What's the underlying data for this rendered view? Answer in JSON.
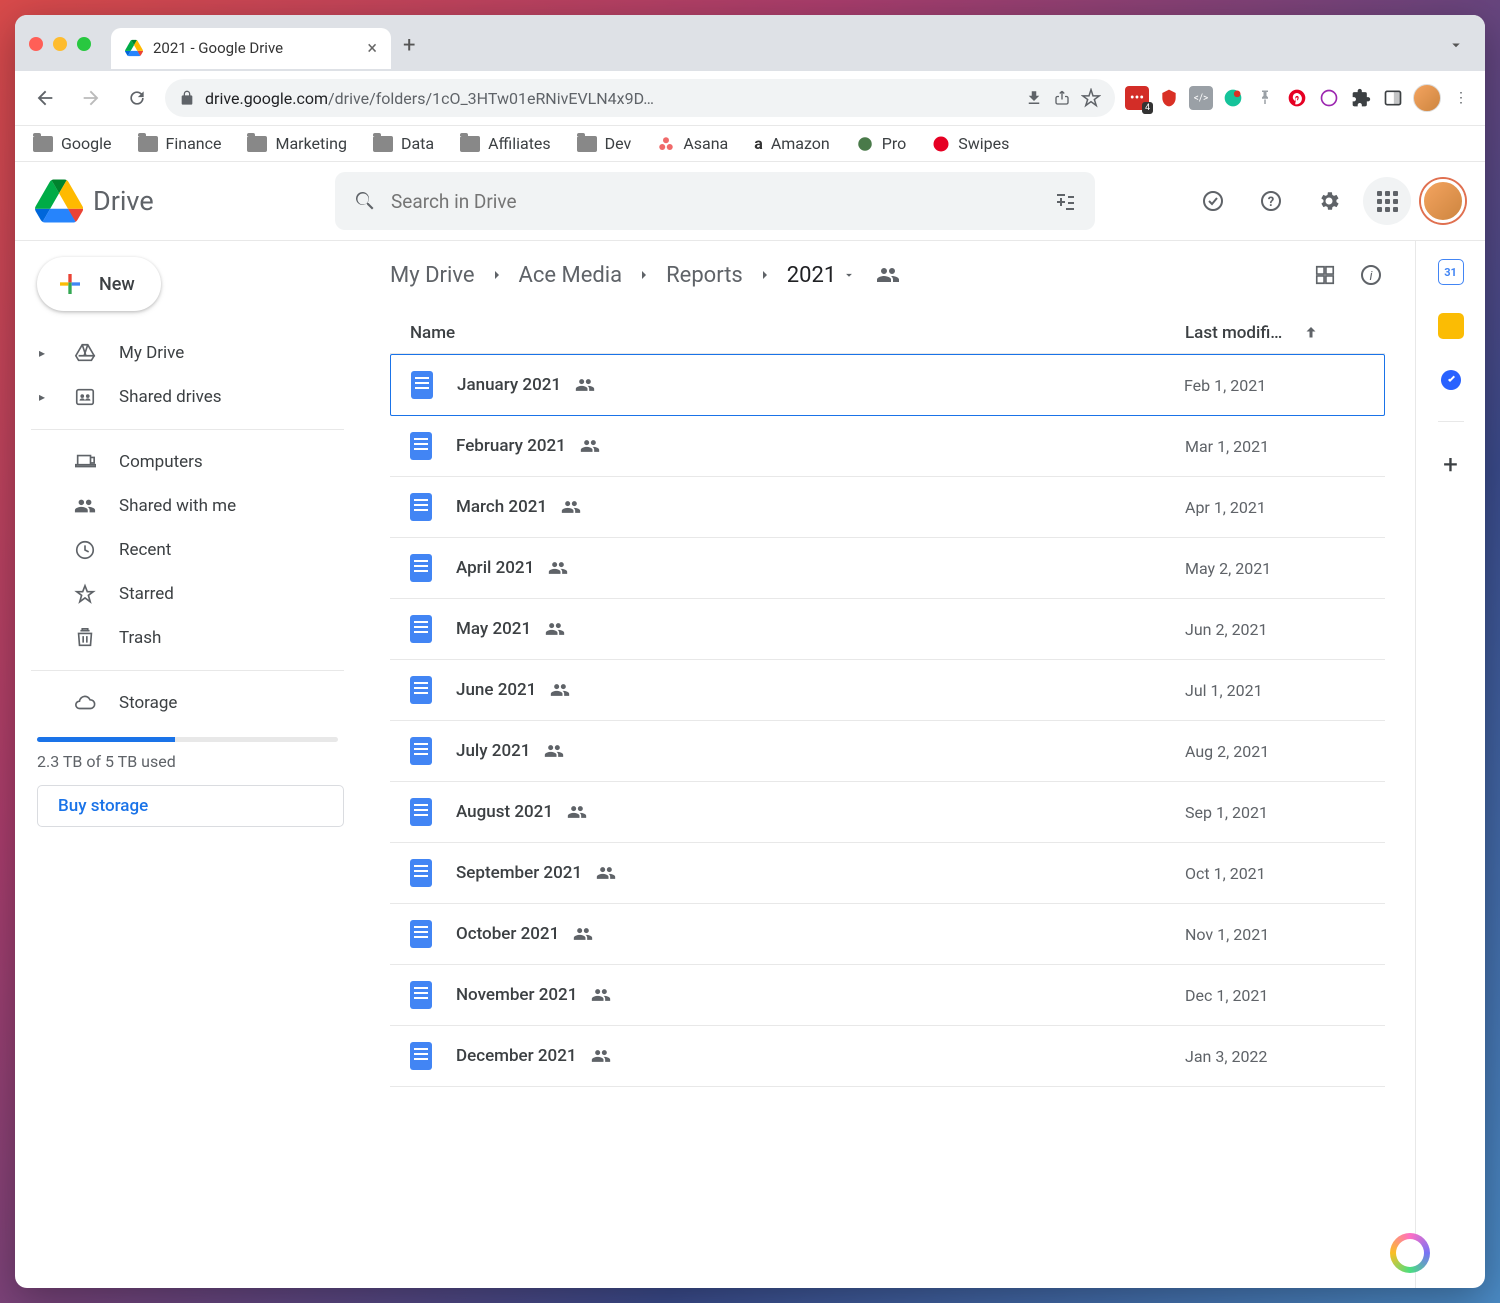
{
  "browser": {
    "tab_title": "2021 - Google Drive",
    "url_host": "drive.google.com",
    "url_path": "/drive/folders/1cO_3HTw01eRNivEVLN4x9D…",
    "ext_badge": "4",
    "bookmarks": [
      "Google",
      "Finance",
      "Marketing",
      "Data",
      "Affiliates",
      "Dev",
      "Asana",
      "Amazon",
      "Pro",
      "Swipes"
    ]
  },
  "drive": {
    "logo": "Drive",
    "search_placeholder": "Search in Drive",
    "new_button": "New",
    "nav": {
      "my_drive": "My Drive",
      "shared_drives": "Shared drives",
      "computers": "Computers",
      "shared_with_me": "Shared with me",
      "recent": "Recent",
      "starred": "Starred",
      "trash": "Trash",
      "storage": "Storage"
    },
    "storage_text": "2.3 TB of 5 TB used",
    "buy_storage": "Buy storage",
    "breadcrumb": [
      "My Drive",
      "Ace Media",
      "Reports",
      "2021"
    ],
    "columns": {
      "name": "Name",
      "modified": "Last modifi…"
    },
    "files": [
      {
        "name": "January 2021",
        "date": "Feb 1, 2021",
        "selected": true
      },
      {
        "name": "February 2021",
        "date": "Mar 1, 2021",
        "selected": false
      },
      {
        "name": "March 2021",
        "date": "Apr 1, 2021",
        "selected": false
      },
      {
        "name": "April 2021",
        "date": "May 2, 2021",
        "selected": false
      },
      {
        "name": "May 2021",
        "date": "Jun 2, 2021",
        "selected": false
      },
      {
        "name": "June 2021",
        "date": "Jul 1, 2021",
        "selected": false
      },
      {
        "name": "July 2021",
        "date": "Aug 2, 2021",
        "selected": false
      },
      {
        "name": "August 2021",
        "date": "Sep 1, 2021",
        "selected": false
      },
      {
        "name": "September 2021",
        "date": "Oct 1, 2021",
        "selected": false
      },
      {
        "name": "October 2021",
        "date": "Nov 1, 2021",
        "selected": false
      },
      {
        "name": "November 2021",
        "date": "Dec 1, 2021",
        "selected": false
      },
      {
        "name": "December 2021",
        "date": "Jan 3, 2022",
        "selected": false
      }
    ]
  }
}
